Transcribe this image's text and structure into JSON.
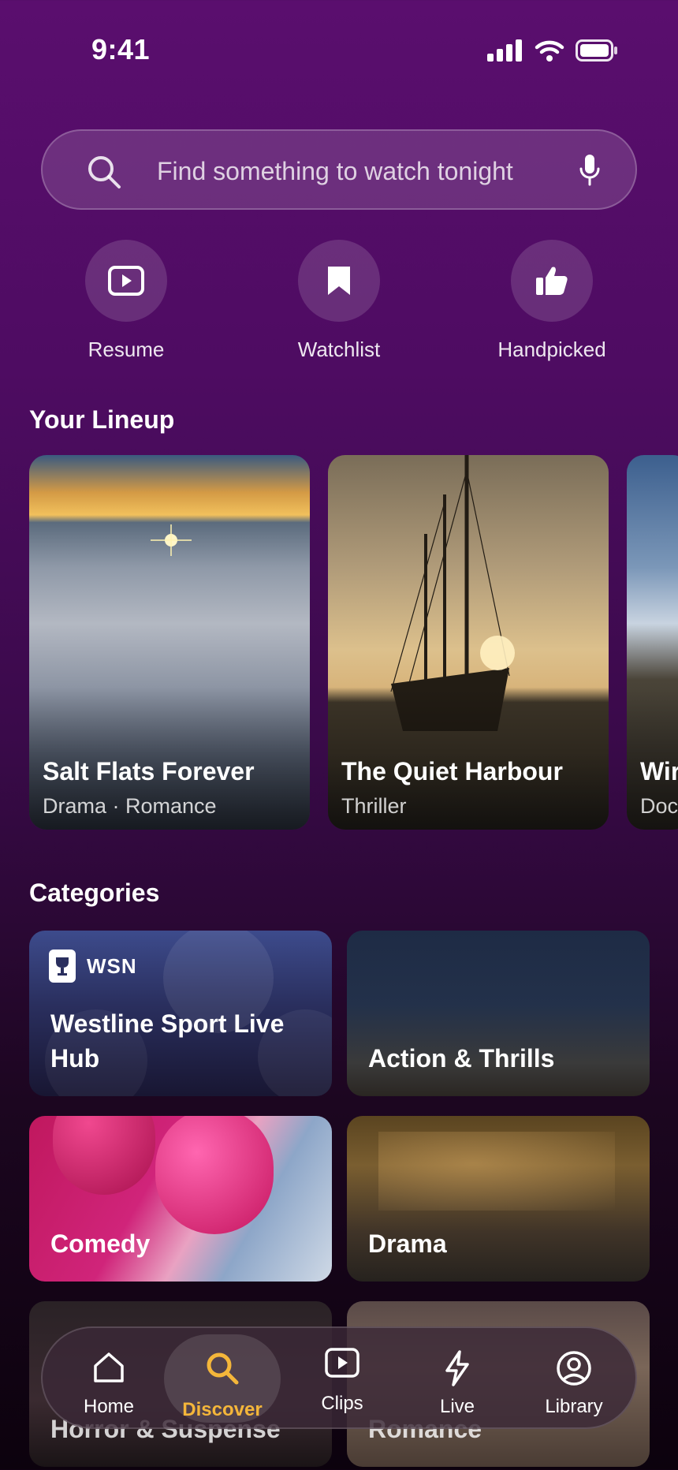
{
  "status": {
    "time": "9:41"
  },
  "search": {
    "placeholder": "Find something to watch tonight"
  },
  "quick_actions": [
    {
      "label": "Resume",
      "icon": "play-square-icon"
    },
    {
      "label": "Watchlist",
      "icon": "bookmark-icon"
    },
    {
      "label": "Handpicked",
      "icon": "thumbs-up-icon"
    }
  ],
  "lineup": {
    "title": "Your Lineup",
    "items": [
      {
        "title": "Salt Flats Forever",
        "genre": "Drama · Romance"
      },
      {
        "title": "The Quiet Harbour",
        "genre": "Thriller"
      },
      {
        "title": "Wir",
        "genre": "Doc"
      }
    ]
  },
  "categories": {
    "title": "Categories",
    "badge": "WSN",
    "items": [
      {
        "label": "Westline Sport Live Hub"
      },
      {
        "label": "Action & Thrills"
      },
      {
        "label": "Comedy"
      },
      {
        "label": "Drama"
      },
      {
        "label": "Horror & Suspense"
      },
      {
        "label": "Romance"
      }
    ]
  },
  "tabbar": {
    "active": "Discover",
    "active_color": "#f4b63a",
    "tabs": [
      {
        "label": "Home",
        "icon": "home-icon"
      },
      {
        "label": "Discover",
        "icon": "search-icon"
      },
      {
        "label": "Clips",
        "icon": "play-square-icon"
      },
      {
        "label": "Live",
        "icon": "bolt-icon"
      },
      {
        "label": "Library",
        "icon": "user-circle-icon"
      }
    ]
  }
}
